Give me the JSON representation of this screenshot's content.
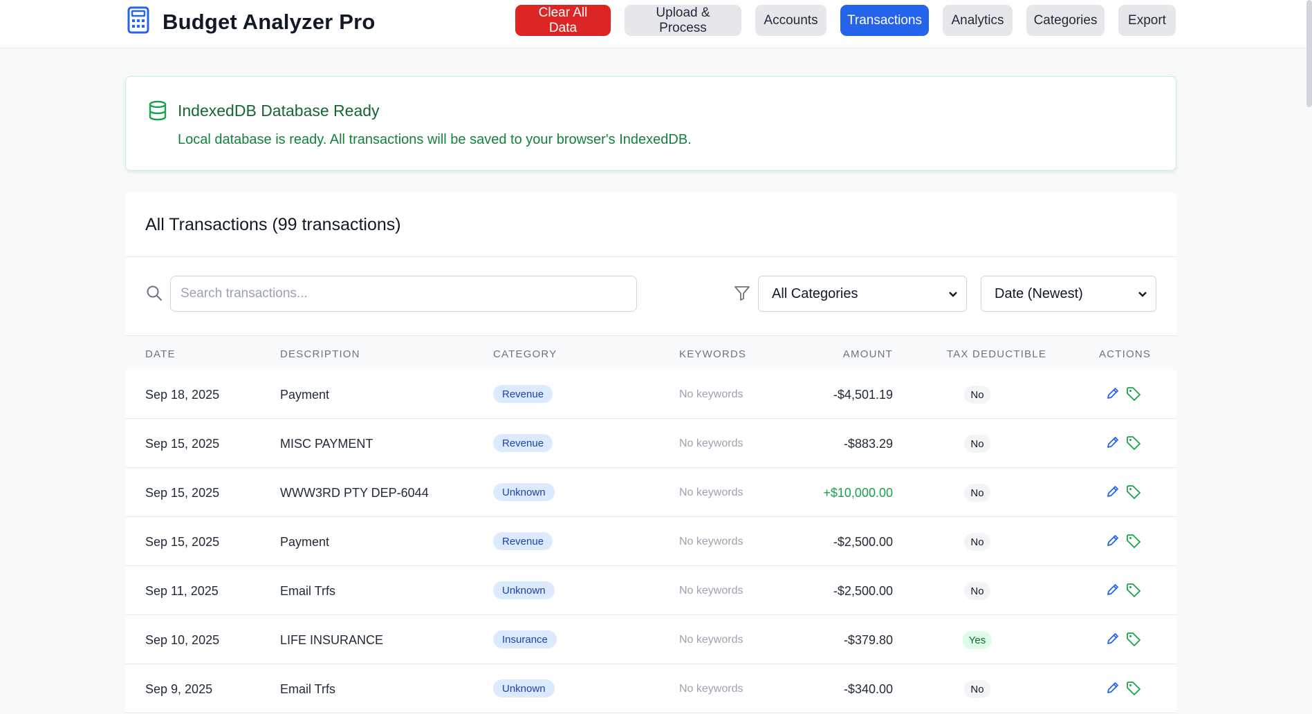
{
  "app": {
    "title": "Budget Analyzer Pro"
  },
  "nav": {
    "clear": "Clear All Data",
    "upload": "Upload & Process",
    "accounts": "Accounts",
    "transactions": "Transactions",
    "analytics": "Analytics",
    "categories": "Categories",
    "export": "Export"
  },
  "db": {
    "title": "IndexedDB Database Ready",
    "message": "Local database is ready. All transactions will be saved to your browser's IndexedDB."
  },
  "transactions": {
    "heading": "All Transactions (99 transactions)",
    "search_placeholder": "Search transactions...",
    "category_filter": "All Categories",
    "sort": "Date (Newest)",
    "columns": [
      "DATE",
      "DESCRIPTION",
      "CATEGORY",
      "KEYWORDS",
      "AMOUNT",
      "TAX DEDUCTIBLE",
      "ACTIONS"
    ],
    "rows": [
      {
        "date": "Sep 18, 2025",
        "description": "Payment",
        "category": "Revenue",
        "keywords": "No keywords",
        "amount": "-$4,501.19",
        "tax": "No"
      },
      {
        "date": "Sep 15, 2025",
        "description": "MISC PAYMENT",
        "category": "Revenue",
        "keywords": "No keywords",
        "amount": "-$883.29",
        "tax": "No"
      },
      {
        "date": "Sep 15, 2025",
        "description": "WWW3RD PTY DEP-6044",
        "category": "Unknown",
        "keywords": "No keywords",
        "amount": "+$10,000.00",
        "tax": "No"
      },
      {
        "date": "Sep 15, 2025",
        "description": "Payment",
        "category": "Revenue",
        "keywords": "No keywords",
        "amount": "-$2,500.00",
        "tax": "No"
      },
      {
        "date": "Sep 11, 2025",
        "description": "Email Trfs",
        "category": "Unknown",
        "keywords": "No keywords",
        "amount": "-$2,500.00",
        "tax": "No"
      },
      {
        "date": "Sep 10, 2025",
        "description": "LIFE INSURANCE",
        "category": "Insurance",
        "keywords": "No keywords",
        "amount": "-$379.80",
        "tax": "Yes"
      },
      {
        "date": "Sep 9, 2025",
        "description": "Email Trfs",
        "category": "Unknown",
        "keywords": "No keywords",
        "amount": "-$340.00",
        "tax": "No"
      }
    ]
  },
  "icons": {
    "brand": "calculator-icon",
    "db": "database-icon",
    "search": "search-icon",
    "filter": "filter-icon",
    "edit": "pencil-icon",
    "tag": "tag-icon",
    "select": "chevron-down-icon"
  },
  "colors": {
    "primary": "#2563eb",
    "danger": "#dc2626",
    "success": "#16a34a",
    "badge_bg": "#dbeafe",
    "badge_text": "#1e40af"
  }
}
